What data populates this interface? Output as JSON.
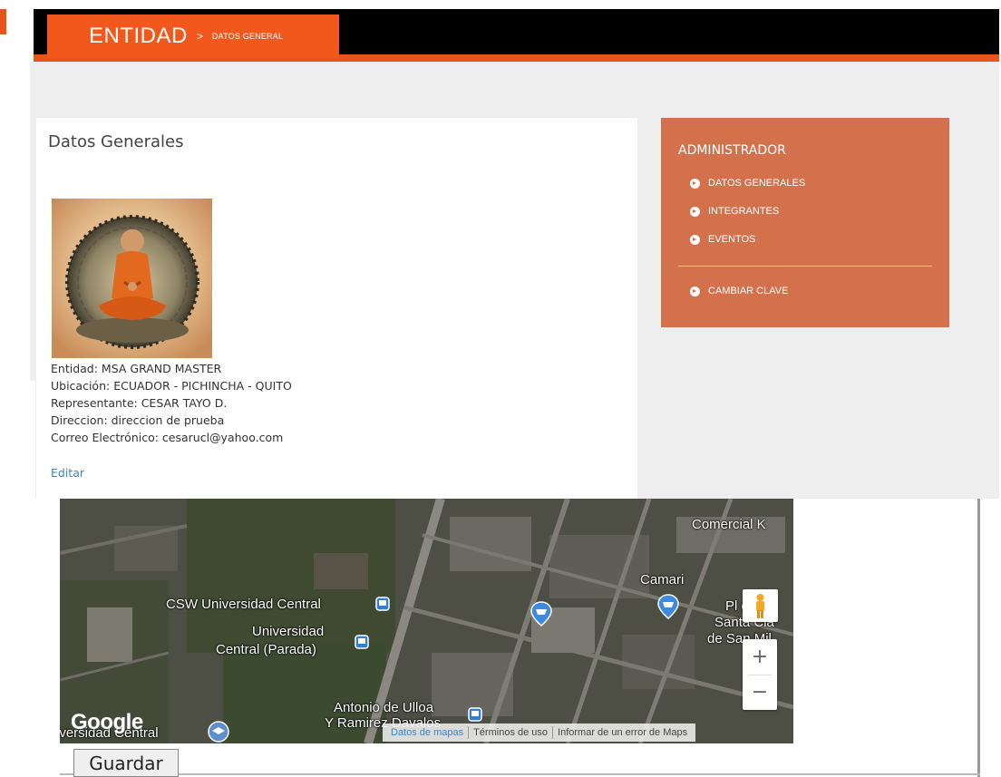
{
  "header": {
    "section": "ENTIDAD",
    "separator": ">",
    "subsection": "DATOS GENERAL"
  },
  "panel": {
    "title": "Datos Generales",
    "avatar_alt": "monk-meditating-logo",
    "info": [
      "Entidad: MSA GRAND MASTER",
      "Ubicación: ECUADOR - PICHINCHA - QUITO",
      "Representante: CESAR TAYO D.",
      "Direccion: direccion de prueba",
      "Correo Electrónico: cesarucl@yahoo.com"
    ],
    "edit_label": "Editar"
  },
  "admin": {
    "title": "ADMINISTRADOR",
    "items": [
      "DATOS GENERALES",
      "INTEGRANTES",
      "EVENTOS"
    ],
    "secondary": [
      "CAMBIAR CLAVE"
    ]
  },
  "map": {
    "labels": [
      "Comercial K",
      "Camari",
      "CSW Universidad Central",
      "Universidad",
      "Central (Parada)",
      "Antonio de Ulloa",
      "Y Ramirez Davalos",
      "Pl de",
      "Santa Cla",
      "de San Mil",
      "iversidad Central"
    ],
    "logo": "Google",
    "footer": [
      "Datos de mapas",
      "Términos de uso",
      "Informar de un error de Maps"
    ],
    "zoom_in": "+",
    "zoom_out": "−"
  },
  "form": {
    "save_label": "Guardar"
  },
  "colors": {
    "accent": "#f2581b",
    "sidebar": "#d3714d",
    "link": "#3a87c7"
  }
}
